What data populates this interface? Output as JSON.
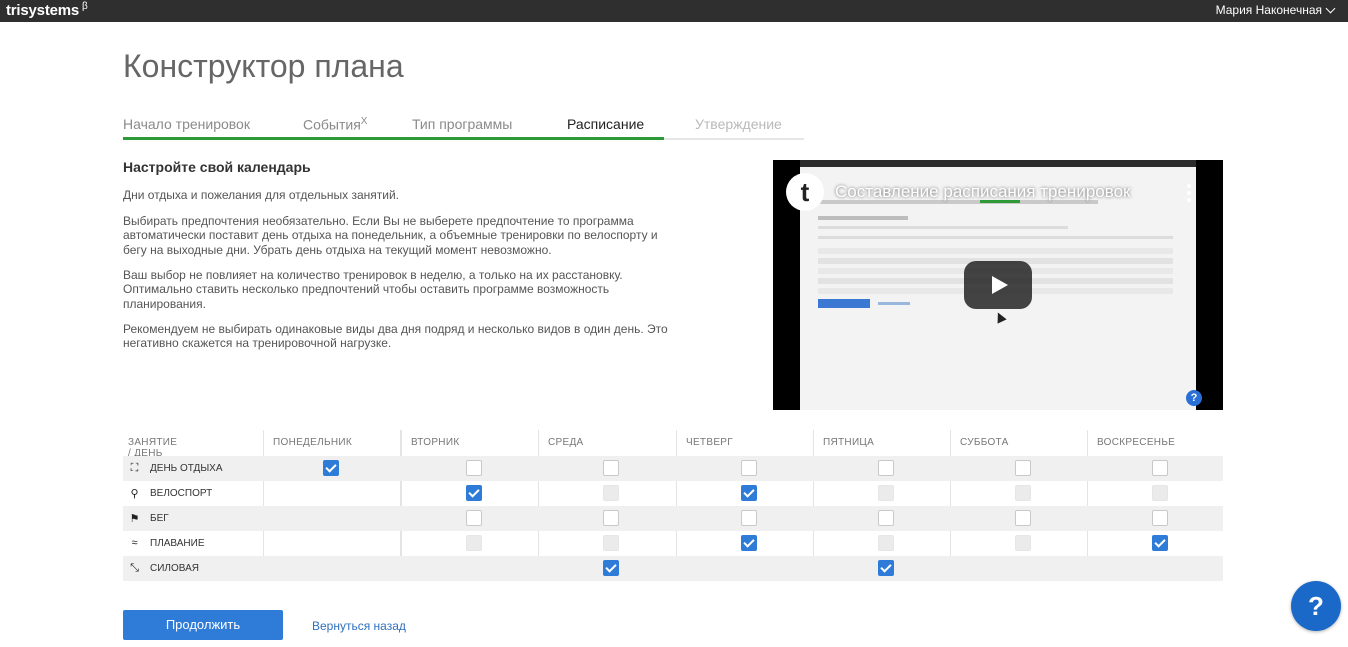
{
  "header": {
    "brand": "trisystems",
    "brand_sup": "β",
    "user_name": "Мария Наконечная"
  },
  "page_title": "Конструктор плана",
  "steps": [
    {
      "label": "Начало тренировок",
      "sup": ""
    },
    {
      "label": "События",
      "sup": "X"
    },
    {
      "label": "Тип программы",
      "sup": ""
    },
    {
      "label": "Расписание",
      "sup": ""
    },
    {
      "label": "Утверждение",
      "sup": ""
    }
  ],
  "active_step": "Расписание",
  "intro": {
    "subtitle": "Настройте свой календарь",
    "paragraphs": [
      "Дни отдыха и пожелания для отдельных занятий.",
      "Выбирать предпочтения необязательно. Если Вы не выберете предпочтение то программа автоматически поставит день отдыха на понедельник, а объемные тренировки по велоспорту и бегу на выходные дни. Убрать день отдыха на текущий момент невозможно.",
      "Ваш выбор не повлияет на количество тренировок в неделю, а только на их расстановку. Оптимально ставить несколько предпочтений чтобы оставить программе возможность планирования.",
      "Рекомендуем не выбирать одинаковые виды два дня подряд и несколько видов в один день. Это негативно скажется на тренировочной нагрузке."
    ]
  },
  "video": {
    "title": "Составление расписания тренировок",
    "logo_letter": "t",
    "help": "?"
  },
  "schedule": {
    "corner_header": "ЗАНЯТИЕ / ДЕНЬ ОТДЫХА",
    "days": [
      "ПОНЕДЕЛЬНИК",
      "ВТОРНИК",
      "СРЕДА",
      "ЧЕТВЕРГ",
      "ПЯТНИЦА",
      "СУББОТА",
      "ВОСКРЕСЕНЬЕ"
    ],
    "rows": [
      {
        "label": "ДЕНЬ ОТДЫХА",
        "icon": "rest-icon",
        "cells": [
          "on",
          "off",
          "off",
          "off",
          "off",
          "off",
          "off"
        ]
      },
      {
        "label": "ВЕЛОСПОРТ",
        "icon": "bicycle-icon",
        "cells": [
          "none",
          "on",
          "dis",
          "on",
          "dis",
          "dis",
          "dis"
        ]
      },
      {
        "label": "БЕГ",
        "icon": "running-icon",
        "cells": [
          "none",
          "off",
          "off",
          "off",
          "off",
          "off",
          "off"
        ]
      },
      {
        "label": "ПЛАВАНИЕ",
        "icon": "swimming-icon",
        "cells": [
          "none",
          "dis",
          "dis",
          "on",
          "dis",
          "dis",
          "on"
        ]
      },
      {
        "label": "СИЛОВАЯ",
        "icon": "strength-icon",
        "cells": [
          "none",
          "none",
          "on",
          "none",
          "on",
          "none",
          "none"
        ]
      }
    ]
  },
  "actions": {
    "continue": "Продолжить",
    "back": "Вернуться назад"
  },
  "help_button": "?",
  "colors": {
    "accent": "#2f7bd8",
    "progress": "#2e9a37",
    "topbar": "#2f2f2f"
  }
}
